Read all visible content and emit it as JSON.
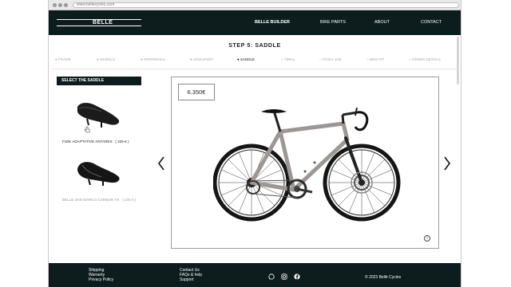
{
  "browser": {
    "url": "www.bellecycles.com"
  },
  "header": {
    "logo_text": "BELLE",
    "nav": [
      "BELLE BUILDER",
      "BIKE PARTS",
      "ABOUT",
      "CONTACT"
    ]
  },
  "builder": {
    "step_title": "STEP 5: SADDLE",
    "steps": [
      "FRAME",
      "WHEELS",
      "PERIFERICS",
      "GROUPSET",
      "SADDLE",
      "TIRES",
      "POINT JOB",
      "BIKE FIT",
      "ORDER DETAILS"
    ],
    "active_step": "SADDLE"
  },
  "sidebar": {
    "heading": "SELECT THE SADDLE",
    "options": [
      {
        "name": "FIZIK ADAPTATIVE ANTARES",
        "price": "( 229 € )"
      },
      {
        "name": "BELLE SAN MARCO CARBON FX",
        "price": "( 240 € )"
      }
    ]
  },
  "viewer": {
    "price": "6.350€",
    "info": "i"
  },
  "footer": {
    "col1": [
      "Shipping",
      "Warranty",
      "Privacy Policy"
    ],
    "col2": [
      "Contact Us",
      "FAQs & help",
      "Support"
    ],
    "copyright": "© 2023 Bellé Cycles"
  },
  "icons": {
    "social": [
      "whatsapp-icon",
      "instagram-icon",
      "facebook-icon"
    ],
    "arrows": [
      "chevron-left-icon",
      "chevron-right-icon"
    ]
  },
  "colors": {
    "dark": "#0d1d1d",
    "frame": "#9c9794"
  }
}
